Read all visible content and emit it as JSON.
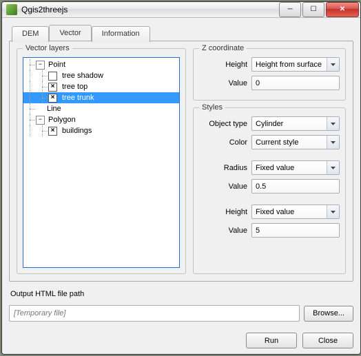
{
  "window": {
    "title": "Qgis2threejs"
  },
  "titlebar_buttons": {
    "min": "─",
    "max": "☐",
    "close": "✕"
  },
  "tabs": {
    "dem": "DEM",
    "vector": "Vector",
    "information": "Information"
  },
  "vector_layers": {
    "legend": "Vector layers",
    "tree": {
      "point": "Point",
      "tree_shadow": "tree shadow",
      "tree_top": "tree top",
      "tree_trunk": "tree trunk",
      "line": "Line",
      "polygon": "Polygon",
      "buildings": "buildings"
    }
  },
  "z_coordinate": {
    "legend": "Z coordinate",
    "height_label": "Height",
    "height_value": "Height from surface",
    "value_label": "Value",
    "value": "0"
  },
  "styles": {
    "legend": "Styles",
    "object_type_label": "Object type",
    "object_type": "Cylinder",
    "color_label": "Color",
    "color": "Current style",
    "radius_label": "Radius",
    "radius_mode": "Fixed value",
    "radius_value_label": "Value",
    "radius_value": "0.5",
    "height_label": "Height",
    "height_mode": "Fixed value",
    "height_value_label": "Value",
    "height_value": "5"
  },
  "output": {
    "label": "Output HTML file path",
    "placeholder": "[Temporary file]",
    "browse": "Browse..."
  },
  "buttons": {
    "run": "Run",
    "close": "Close"
  }
}
